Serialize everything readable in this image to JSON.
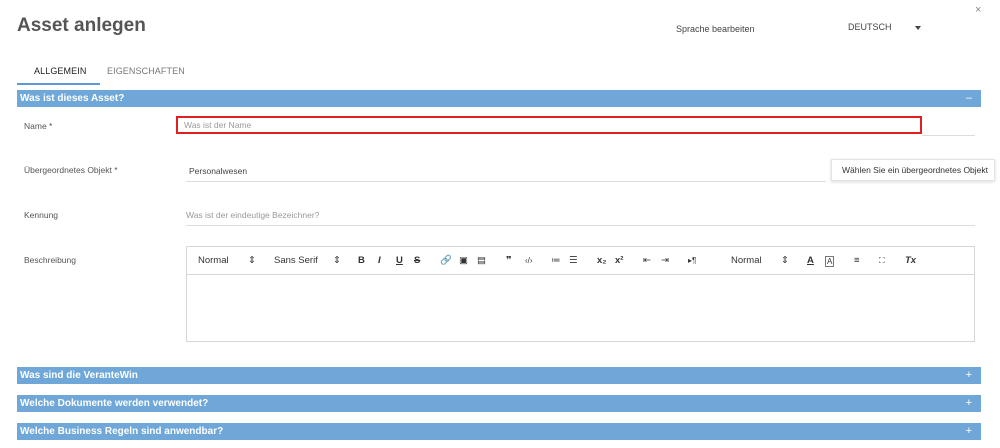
{
  "dialog": {
    "title": "Asset anlegen",
    "close_label": "×",
    "language_label": "Sprache bearbeiten",
    "language_value": "DEUTSCH"
  },
  "tabs": [
    {
      "label": "ALLGEMEIN",
      "active": true
    },
    {
      "label": "EIGENSCHAFTEN",
      "active": false
    }
  ],
  "sections": [
    {
      "title": "Was ist dieses Asset?",
      "toggle": "–",
      "expanded": true
    },
    {
      "title": "Was sind die VeranteWin",
      "toggle": "+",
      "expanded": false
    },
    {
      "title": "Welche Dokumente werden verwendet?",
      "toggle": "+",
      "expanded": false
    },
    {
      "title": "Welche Business Regeln sind anwendbar?",
      "toggle": "+",
      "expanded": false
    }
  ],
  "form": {
    "name": {
      "label": "Name *",
      "placeholder": "Was ist der Name",
      "value": ""
    },
    "parent": {
      "label": "Übergeordnetes Objekt *",
      "value": "Personalwesen",
      "tooltip": "Wählen Sie ein übergeordnetes Objekt"
    },
    "identifier": {
      "label": "Kennung",
      "placeholder": "Was ist der eindeutige Bezeichner?"
    },
    "description": {
      "label": "Beschreibung"
    }
  },
  "editor_toolbar": {
    "heading_select": "Normal",
    "font_select": "Sans Serif",
    "size_select": "Normal",
    "select_arrow": "⇕",
    "bold": "B",
    "italic": "I",
    "underline": "U",
    "strike": "S",
    "link": "🔗",
    "image": "▣",
    "video": "▤",
    "blockquote": "❞",
    "code": "‹/›",
    "ordered_list": "≔",
    "bullet_list": "☰",
    "subscript": "x₂",
    "superscript": "x²",
    "indent_decrease": "⇤",
    "indent_increase": "⇥",
    "direction": "▸¶",
    "text_color": "A",
    "background_color": "A",
    "align": "≡",
    "fullscreen": "⛶",
    "clean": "Tx"
  },
  "colors": {
    "section_bar": "#6ea7d8",
    "tab_underline": "#5a9bd5",
    "highlight_border": "#e02020"
  }
}
